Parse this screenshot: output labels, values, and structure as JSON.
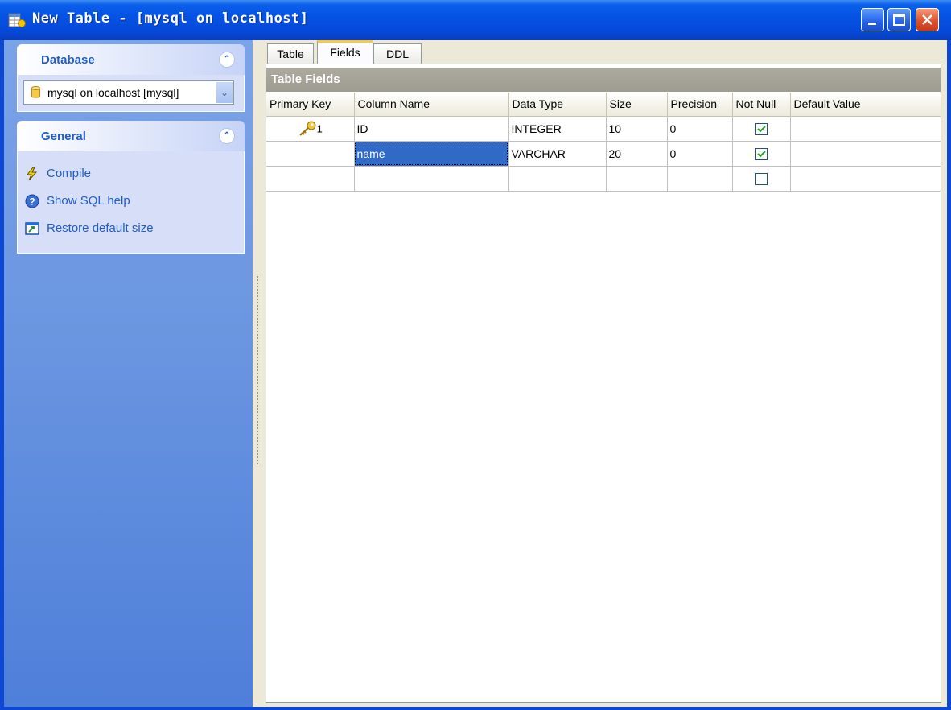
{
  "window": {
    "title": "New Table - [mysql on localhost]"
  },
  "sidebar": {
    "database_panel": {
      "title": "Database",
      "selected_database": "mysql on localhost [mysql]"
    },
    "general_panel": {
      "title": "General",
      "items": [
        {
          "label": "Compile",
          "icon": "lightning-icon"
        },
        {
          "label": "Show SQL help",
          "icon": "help-icon"
        },
        {
          "label": "Restore default size",
          "icon": "restore-window-icon"
        }
      ]
    }
  },
  "tabs": [
    {
      "label": "Table",
      "active": false
    },
    {
      "label": "Fields",
      "active": true
    },
    {
      "label": "DDL",
      "active": false
    }
  ],
  "fields_section": {
    "title": "Table Fields",
    "columns": [
      "Primary Key",
      "Column Name",
      "Data Type",
      "Size",
      "Precision",
      "Not Null",
      "Default Value"
    ],
    "rows": [
      {
        "primary_key": "1",
        "column_name": "ID",
        "data_type": "INTEGER",
        "size": "10",
        "precision": "0",
        "not_null": true,
        "default_value": ""
      },
      {
        "primary_key": "",
        "column_name": "name",
        "data_type": "VARCHAR",
        "size": "20",
        "precision": "0",
        "not_null": true,
        "default_value": ""
      },
      {
        "primary_key": "",
        "column_name": "",
        "data_type": "",
        "size": "",
        "precision": "",
        "not_null": false,
        "default_value": ""
      }
    ]
  }
}
